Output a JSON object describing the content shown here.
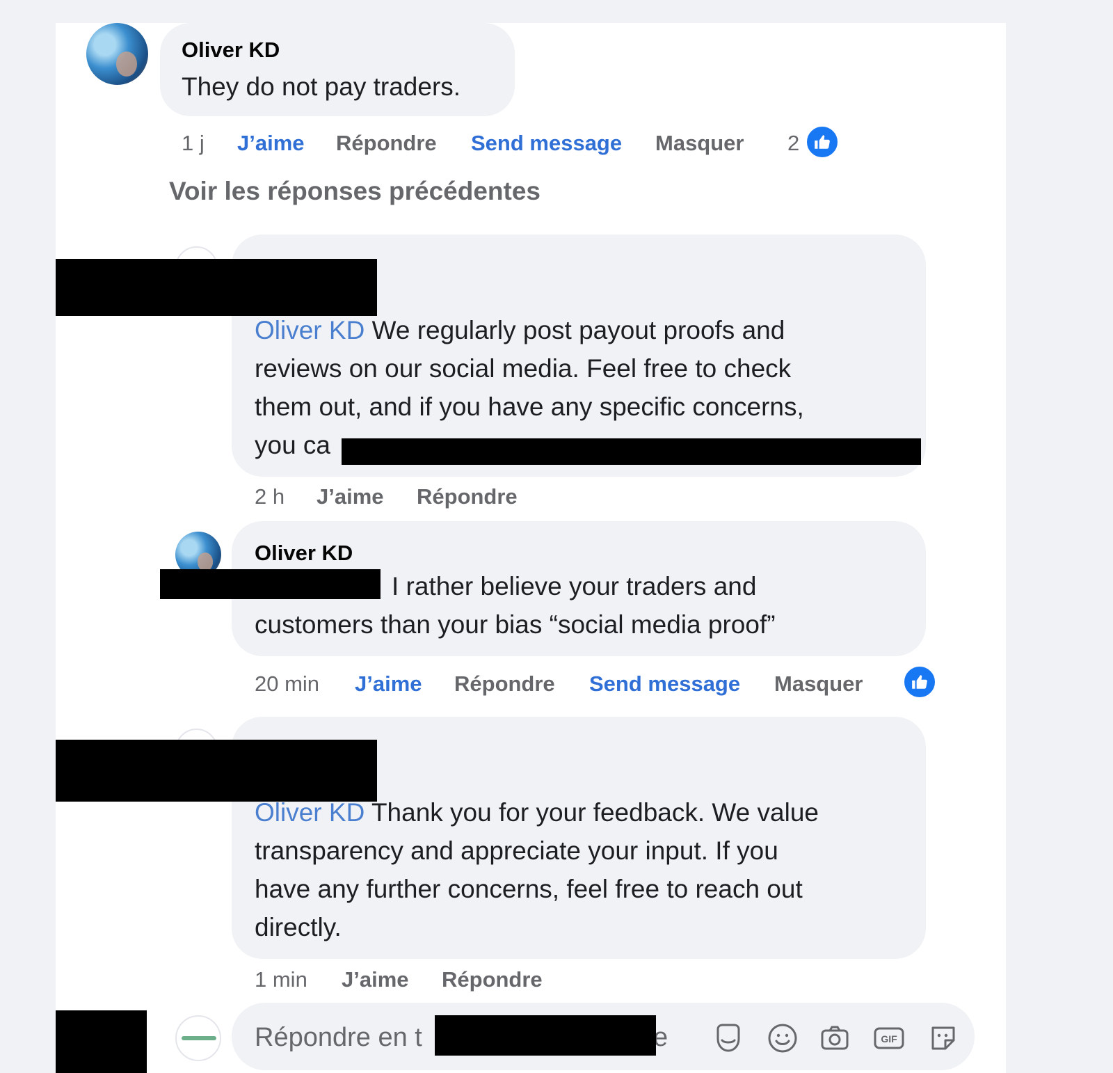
{
  "comment": {
    "author": "Oliver KD",
    "text": "They do not pay traders.",
    "time": "1 j",
    "like_label": "J’aime",
    "reply_label": "Répondre",
    "send_message_label": "Send message",
    "hide_label": "Masquer",
    "like_count": "2"
  },
  "view_previous_label": "Voir les réponses précédentes",
  "reply1": {
    "mention": "Oliver KD",
    "text_before": "We regularly post payout proofs and",
    "text_line2": "reviews on our social media. Feel free to check",
    "text_line3": "them out, and if you have any specific concerns,",
    "text_line4": "you ca",
    "time": "2 h",
    "like_label": "J’aime",
    "reply_label": "Répondre"
  },
  "reply2": {
    "author": "Oliver KD",
    "text_line1": "I rather believe your traders and",
    "text_line2": "customers than your bias “social media proof”",
    "time": "20 min",
    "like_label": "J’aime",
    "reply_label": "Répondre",
    "send_message_label": "Send message",
    "hide_label": "Masquer"
  },
  "reply3": {
    "mention": "Oliver KD",
    "text_line1": "Thank you for your feedback. We value",
    "text_line2": "transparency and appreciate your input. If you",
    "text_line3": "have any further concerns, feel free to reach out",
    "text_line4": "directly.",
    "time": "1 min",
    "like_label": "J’aime",
    "reply_label": "Répondre"
  },
  "reply_input": {
    "placeholder_start": "Répondre en t",
    "placeholder_end": "e"
  },
  "toolbar_icons": [
    "avatar-sticker-icon",
    "emoji-icon",
    "camera-icon",
    "gif-icon",
    "sticker-icon"
  ],
  "colors": {
    "accent": "#1877f2",
    "link": "#2f6fd6",
    "mention": "#4a7fd0",
    "bubble": "#f0f2f5",
    "muted": "#65676b"
  }
}
